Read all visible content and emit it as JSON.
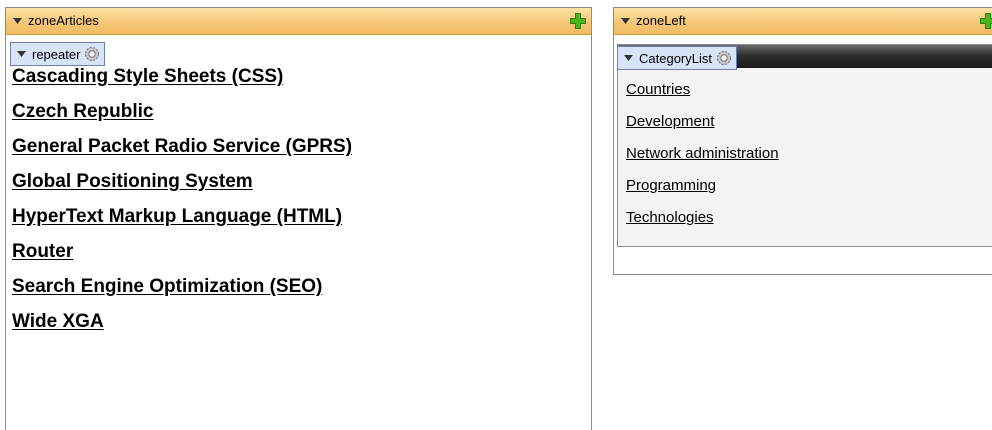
{
  "zone_articles": {
    "title": "zoneArticles",
    "icon": "add-icon",
    "webpart": {
      "label": "repeater",
      "icon": "gear-icon"
    },
    "links": [
      "Cascading Style Sheets (CSS)",
      "Czech Republic",
      "General Packet Radio Service (GPRS)",
      "Global Positioning System",
      "HyperText Markup Language (HTML)",
      "Router",
      "Search Engine Optimization (SEO)",
      "Wide XGA"
    ]
  },
  "zone_left": {
    "title": "zoneLeft",
    "icon": "add-icon",
    "webpart": {
      "label": "CategoryList",
      "icon": "gear-icon"
    },
    "categories": [
      "Countries",
      "Development",
      "Network administration",
      "Programming",
      "Technologies"
    ]
  },
  "colors": {
    "zone_header": "#f6c777",
    "webpart_handle": "#d7e3f7",
    "add_icon": "#4cb51a",
    "category_bar": "#2e2e2e"
  }
}
